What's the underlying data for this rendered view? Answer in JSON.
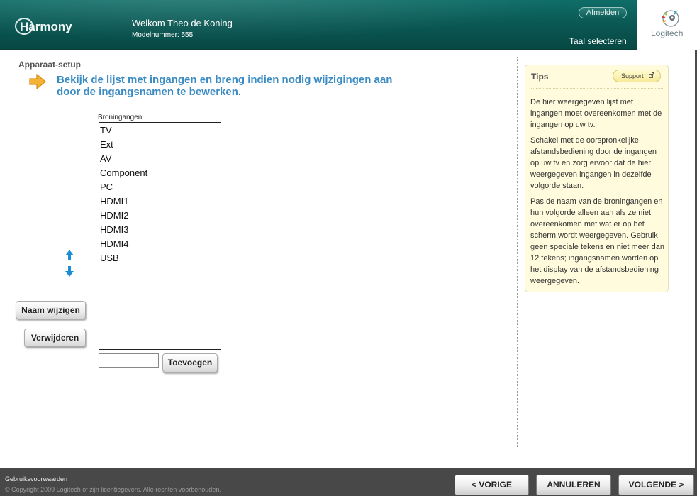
{
  "header": {
    "logo_text": "Harmony",
    "welcome": "Welkom Theo de Koning",
    "model": "Modelnummer: 555",
    "logout_label": "Afmelden",
    "language_label": "Taal selecteren",
    "brand": "Logitech"
  },
  "page": {
    "section_title": "Apparaat-setup",
    "instruction": "Bekijk de lijst met ingangen en breng indien nodig wijzigingen aan door de ingangsnamen te bewerken."
  },
  "inputs": {
    "label": "Broningangen",
    "items": [
      "TV",
      "Ext",
      "AV",
      "Component",
      "PC",
      "HDMI1",
      "HDMI2",
      "HDMI3",
      "HDMI4",
      "USB"
    ],
    "new_input_value": "",
    "rename_label": "Naam wijzigen",
    "remove_label": "Verwijderen",
    "add_label": "Toevoegen"
  },
  "tips": {
    "title": "Tips",
    "support_label": "Support",
    "paragraphs": [
      "De hier weergegeven lijst met ingangen moet overeenkomen met de ingangen op uw tv.",
      "Schakel met de oorspronkelijke afstandsbediening door de ingangen op uw tv en zorg ervoor dat de hier weergegeven ingangen in dezelfde volgorde staan.",
      "Pas de naam van de broningangen en hun volgorde alleen aan als ze niet overeenkomen met wat er op het scherm wordt weergegeven. Gebruik geen speciale tekens en niet meer dan 12 tekens; ingangsnamen worden op het display van de afstandsbediening weergegeven."
    ]
  },
  "footer": {
    "terms": "Gebruiksvoorwaarden",
    "copyright": "© Copyright 2009 Logitech of zijn licentiegevers. Alle rechten voorbehouden.",
    "prev_label": "< VORIGE",
    "cancel_label": "ANNULEREN",
    "next_label": "VOLGENDE >"
  },
  "colors": {
    "header_teal": "#0a5652",
    "instruction_blue": "#3c8cc4",
    "tips_bg": "#fffbdc",
    "arrow_orange": "#f0a21c"
  }
}
